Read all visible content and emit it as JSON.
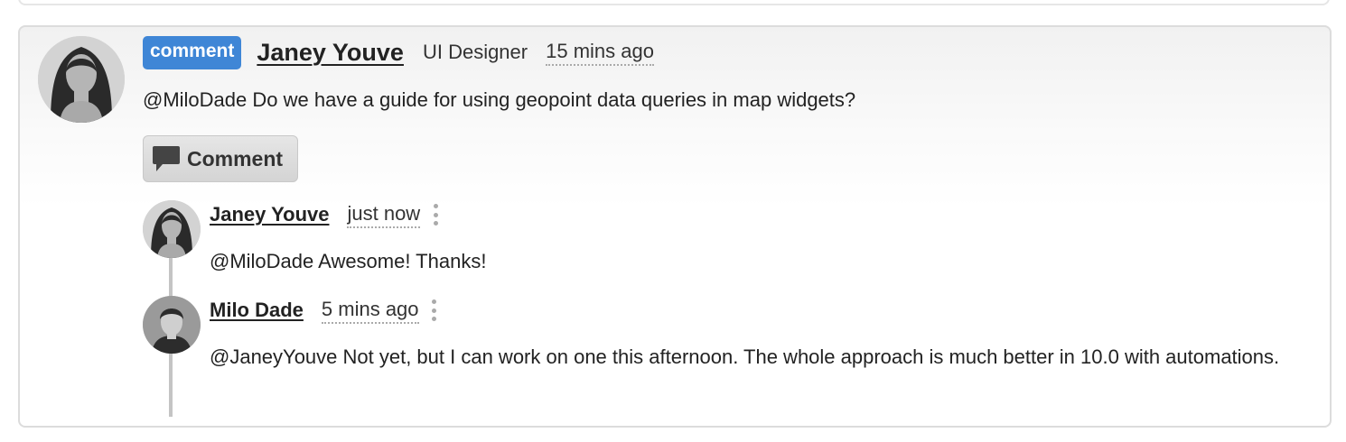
{
  "main_comment": {
    "badge": "comment",
    "author": "Janey Youve",
    "role": "UI Designer",
    "time": "15 mins ago",
    "text": "@MiloDade Do we have a guide for using geopoint data queries in map widgets?",
    "comment_button_label": "Comment"
  },
  "replies": [
    {
      "author": "Janey Youve",
      "time": "just now",
      "text": "@MiloDade Awesome! Thanks!"
    },
    {
      "author": "Milo Dade",
      "time": "5 mins ago",
      "text": "@JaneyYouve Not yet, but I can work on one this afternoon. The whole approach is much better in 10.0 with automations."
    }
  ],
  "colors": {
    "badge": "#3f86d6",
    "thread_line": "#c4c4c4"
  },
  "icons": {
    "comment_button": "speech-bubble-icon",
    "reply_menu": "kebab-menu-icon"
  }
}
